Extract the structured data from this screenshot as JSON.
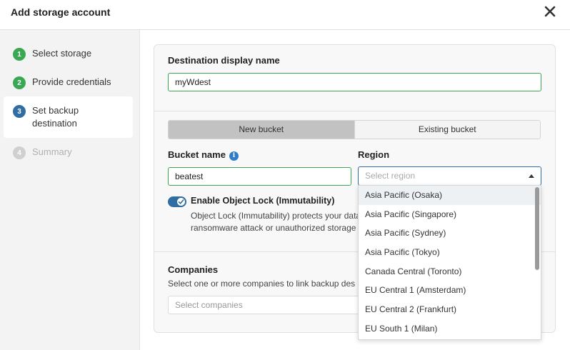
{
  "dialog": {
    "title": "Add storage account"
  },
  "steps": [
    {
      "number": "1",
      "label": "Select storage",
      "state": "done"
    },
    {
      "number": "2",
      "label": "Provide credentials",
      "state": "done"
    },
    {
      "number": "3",
      "label": "Set backup",
      "label2": "destination",
      "state": "current"
    },
    {
      "number": "4",
      "label": "Summary",
      "state": "todo"
    }
  ],
  "destination": {
    "label": "Destination display name",
    "value": "myWdest"
  },
  "bucket_toggle": {
    "new_label": "New bucket",
    "existing_label": "Existing bucket",
    "selected": "New bucket"
  },
  "bucket_name": {
    "label": "Bucket name",
    "info_icon": "i",
    "value": "beatest"
  },
  "region": {
    "label": "Region",
    "placeholder": "Select region",
    "options": [
      "Asia Pacific (Osaka)",
      "Asia Pacific (Singapore)",
      "Asia Pacific (Sydney)",
      "Asia Pacific (Tokyo)",
      "Canada Central (Toronto)",
      "EU Central 1 (Amsterdam)",
      "EU Central 2 (Frankfurt)",
      "EU South 1 (Milan)"
    ]
  },
  "object_lock": {
    "label": "Enable Object Lock (Immutability)",
    "enabled": true,
    "desc_line1": "Object Lock (Immutability) protects your data o",
    "desc_line2": "ransomware attack or unauthorized storage ac"
  },
  "companies": {
    "label": "Companies",
    "desc": "Select one or more companies to link backup des",
    "placeholder": "Select companies"
  },
  "colors": {
    "accent_green": "#3aa853",
    "accent_blue": "#2f6da3",
    "info_blue": "#2f7cc8"
  },
  "icons": {
    "close": "close-icon",
    "info": "info-icon",
    "check": "check-icon",
    "caret": "chevron-up-icon"
  }
}
